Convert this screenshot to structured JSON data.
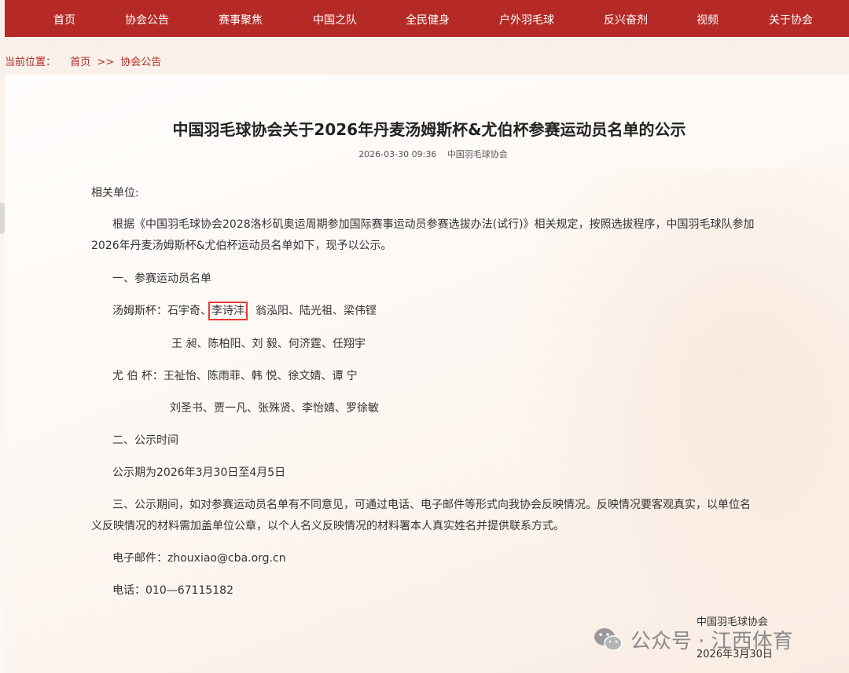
{
  "nav": {
    "items": [
      "首页",
      "协会公告",
      "赛事聚焦",
      "中国之队",
      "全民健身",
      "户外羽毛球",
      "反兴奋剂",
      "视频",
      "关于协会"
    ],
    "bg_color": "#b52a26"
  },
  "breadcrumb": {
    "label": "当前位置：",
    "home": "首页",
    "sep": ">>",
    "current": "协会公告"
  },
  "article": {
    "title": "中国羽毛球协会关于2026年丹麦汤姆斯杯&尤伯杯参赛运动员名单的公示",
    "date": "2026-03-30 09:36",
    "source": "中国羽毛球协会",
    "greeting": "相关单位:",
    "intro_line1": "根据《中国羽毛球协会2028洛杉矶奥运周期参加国际赛事运动员参赛选拔办法(试行)》相关规定，按照选拔程序，中国羽毛球队参加",
    "intro_line2": "2026年丹麦汤姆斯杯&尤伯杯运动员名单如下，现予以公示。",
    "section1": "一、参赛运动员名单",
    "thomas_label": "汤姆斯杯：",
    "thomas_before": "石宇奇、",
    "thomas_highlight": "李诗沣",
    "thomas_after": "、翁泓阳、陆光祖、梁伟铿",
    "thomas_line2": "王 昶、陈柏阳、刘 毅、何济霆、任翔宇",
    "uber_label": "尤 伯 杯：",
    "uber_line1": "王祉怡、陈雨菲、韩 悦、徐文婧、谭 宁",
    "uber_line2": "刘圣书、贾一凡、张殊贤、李怡婧、罗徐敏",
    "section2": "二、公示时间",
    "period": "公示期为2026年3月30日至4月5日",
    "section3_line1": "三、公示期间，如对参赛运动员名单有不同意见，可通过电话、电子邮件等形式向我协会反映情况。反映情况要客观真实，以单位名",
    "section3_line2": "义反映情况的材料需加盖单位公章，以个人名义反映情况的材料署本人真实姓名并提供联系方式。",
    "email": "电子邮件：zhouxiao@cba.org.cn",
    "phone": "电话：010—67115182",
    "signature": "中国羽毛球协会",
    "sign_date": "2026年3月30日"
  },
  "watermark": {
    "icon": "wechat-icon",
    "text": "公众号 · 江西体育"
  },
  "colors": {
    "accent": "#b52a26",
    "highlight_box": "#e53b35"
  }
}
